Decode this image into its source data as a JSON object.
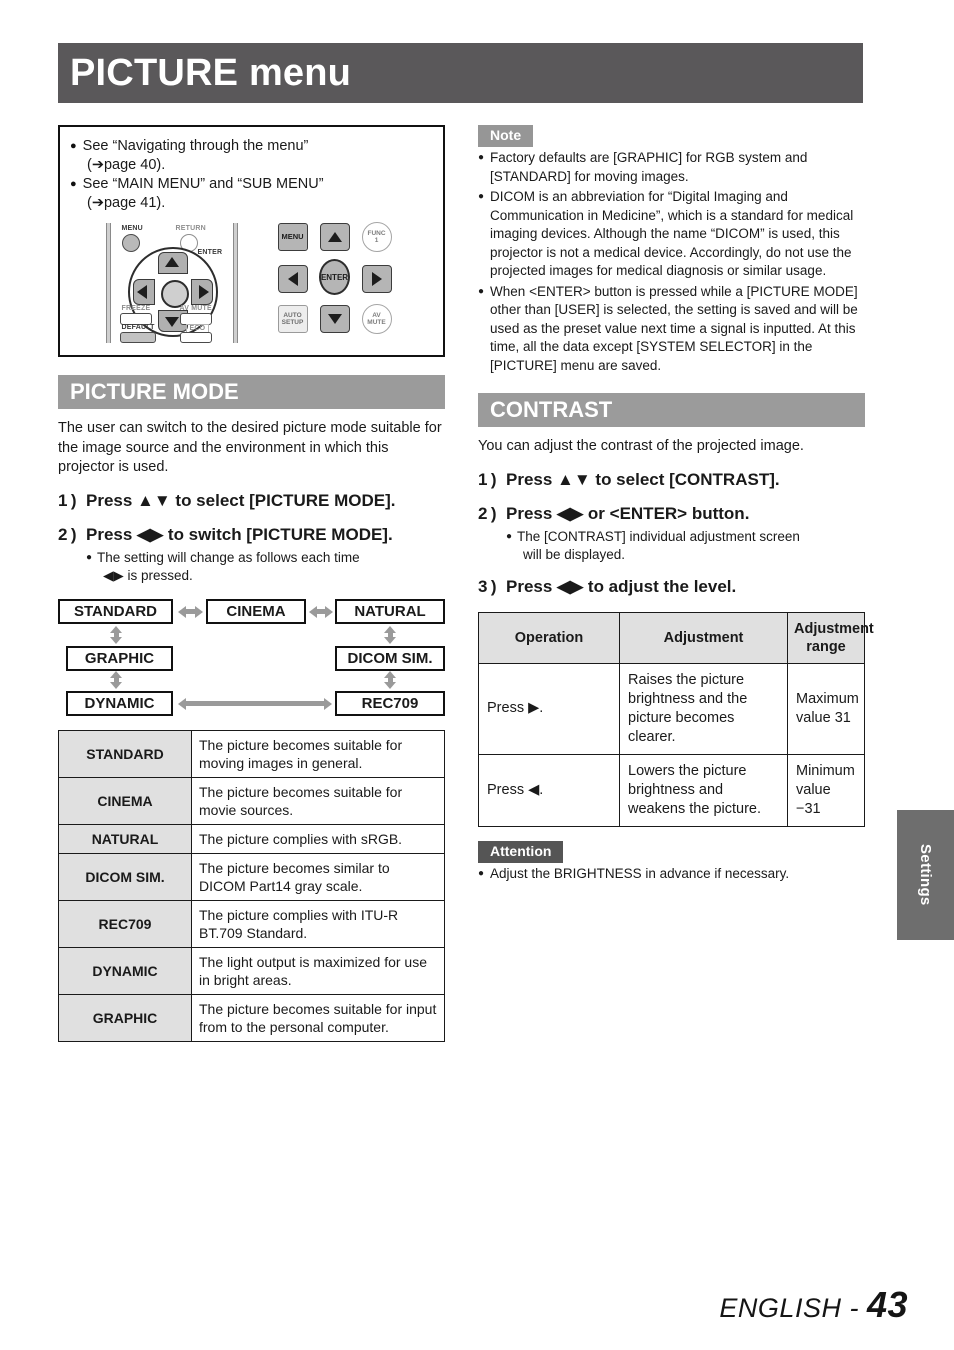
{
  "page": {
    "title": "PICTURE menu",
    "footer_language": "ENGLISH - ",
    "footer_page": "43",
    "side_tab": "Settings"
  },
  "intro_box": {
    "items": [
      {
        "text": "See “Navigating through the menu”",
        "ref": "(➔page 40)."
      },
      {
        "text": "See “MAIN MENU” and “SUB MENU”",
        "ref": "(➔page 41)."
      }
    ]
  },
  "remote": {
    "left_labels": [
      "MENU",
      "RETURN",
      "ENTER",
      "FREEZE",
      "AV MUTE",
      "DEFAULT",
      "ECO"
    ],
    "right_keys": [
      "MENU",
      "▲",
      "FUNC 1",
      "◀",
      "ENTER",
      "▶",
      "AUTO SETUP",
      "▼",
      "AV MUTE"
    ]
  },
  "picture_mode": {
    "heading": "PICTURE MODE",
    "intro": "The user can switch to the desired picture mode suitable for the image source and the environment in which this projector is used.",
    "steps": [
      {
        "num": "1 )",
        "text": "Press ▲▼ to select [PICTURE MODE]."
      },
      {
        "num": "2 )",
        "text": "Press ◀▶ to switch [PICTURE MODE].",
        "sub": "The setting will change as follows each time",
        "sub2": "◀▶ is pressed."
      }
    ],
    "flow": {
      "standard": "STANDARD",
      "cinema": "CINEMA",
      "natural": "NATURAL",
      "graphic": "GRAPHIC",
      "dicom": "DICOM SIM.",
      "dynamic": "DYNAMIC",
      "rec709": "REC709"
    },
    "table": [
      {
        "mode": "STANDARD",
        "desc": "The picture becomes suitable for moving images in general."
      },
      {
        "mode": "CINEMA",
        "desc": "The picture becomes suitable for movie sources."
      },
      {
        "mode": "NATURAL",
        "desc": "The picture complies with sRGB."
      },
      {
        "mode": "DICOM SIM.",
        "desc": "The picture becomes similar to DICOM Part14 gray scale."
      },
      {
        "mode": "REC709",
        "desc": "The picture complies with ITU-R BT.709 Standard."
      },
      {
        "mode": "DYNAMIC",
        "desc": "The light output is maximized for use in bright areas."
      },
      {
        "mode": "GRAPHIC",
        "desc": "The picture becomes suitable for input from to the personal computer."
      }
    ]
  },
  "note": {
    "label": "Note",
    "items": [
      "Factory defaults are [GRAPHIC] for RGB system and [STANDARD] for moving images.",
      "DICOM is an abbreviation for “Digital Imaging and Communication in Medicine”, which is a standard for medical imaging devices. Although the name “DICOM” is used, this projector is not a medical device. Accordingly, do not use the projected images for medical diagnosis or similar usage.",
      "When <ENTER> button is pressed while a [PICTURE MODE] other than [USER] is selected, the setting is saved and will be used as the preset value next time a signal is inputted. At this time, all the data except [SYSTEM SELECTOR] in the [PICTURE] menu are saved."
    ]
  },
  "contrast": {
    "heading": "CONTRAST",
    "intro": "You can adjust the contrast of the projected image.",
    "steps": [
      {
        "num": "1 )",
        "text": "Press ▲▼ to select [CONTRAST]."
      },
      {
        "num": "2 )",
        "text": "Press ◀▶ or <ENTER> button.",
        "sub": "The [CONTRAST] individual adjustment screen",
        "sub2": "will be displayed."
      },
      {
        "num": "3 )",
        "text": "Press ◀▶ to adjust the level."
      }
    ],
    "table": {
      "headers": [
        "Operation",
        "Adjustment",
        "Adjustment range"
      ],
      "rows": [
        {
          "operation": "Press ▶.",
          "adjustment": "Raises the picture brightness and the picture becomes clearer.",
          "range": "Maximum value 31"
        },
        {
          "operation": "Press ◀.",
          "adjustment": "Lowers the picture brightness and weakens the picture.",
          "range": "Minimum value −31"
        }
      ]
    }
  },
  "attention": {
    "label": "Attention",
    "items": [
      "Adjust the BRIGHTNESS in advance if necessary."
    ]
  },
  "colors": {
    "title_bar": "#5a585a",
    "section_header": "#9b9b9b",
    "note_tag": "#969696",
    "attention_tag": "#555555",
    "side_tab": "#6e6e6e",
    "table_header": "#e0e0e0",
    "arrow_gray": "#9a9a9a"
  }
}
